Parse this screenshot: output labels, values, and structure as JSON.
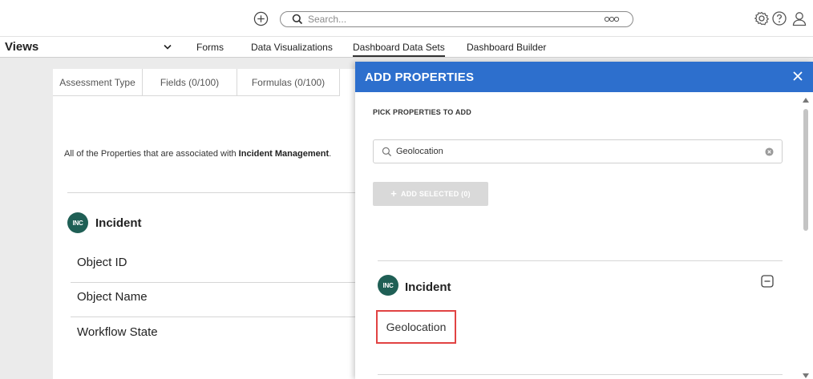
{
  "topbar": {
    "search_placeholder": "Search...",
    "icons": [
      "add-circle-icon",
      "search-icon",
      "more-icon",
      "gear-icon",
      "help-icon",
      "user-icon"
    ]
  },
  "nav": {
    "views_label": "Views",
    "tabs": [
      {
        "label": "Forms"
      },
      {
        "label": "Data Visualizations"
      },
      {
        "label": "Dashboard Data Sets",
        "active": true
      },
      {
        "label": "Dashboard Builder"
      }
    ]
  },
  "panel": {
    "subtabs": [
      {
        "label": "Assessment Type"
      },
      {
        "label": "Fields (0/100)"
      },
      {
        "label": "Formulas (0/100)"
      }
    ],
    "description_prefix": "All of the Properties that are associated with ",
    "description_bold": "Incident Management",
    "description_suffix": ".",
    "object_badge": "INC",
    "object_title": "Incident",
    "properties": [
      "Object ID",
      "Object Name",
      "Workflow State"
    ]
  },
  "drawer": {
    "title": "ADD PROPERTIES",
    "pick_label": "PICK PROPERTIES TO ADD",
    "search_value": "Geolocation",
    "add_selected_label": "ADD SELECTED (0)",
    "object_badge": "INC",
    "object_title": "Incident",
    "result_item": "Geolocation",
    "header_color": "#2d6fcd",
    "highlight_color": "#e14343"
  }
}
